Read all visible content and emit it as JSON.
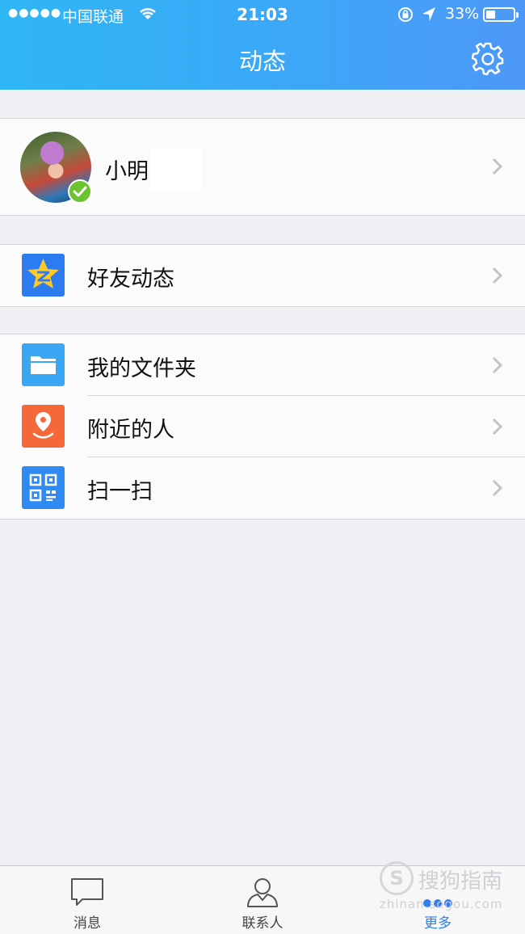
{
  "status_bar": {
    "signal": "●●●●●",
    "carrier": "中国联通",
    "time": "21:03",
    "battery_percent": "33%"
  },
  "header": {
    "title": "动态",
    "settings_icon": "gear-icon"
  },
  "profile": {
    "name": "小明",
    "badge": "check-icon"
  },
  "groups": [
    [
      {
        "label": "好友动态",
        "icon": "qzone-star-icon",
        "color": "#2d7bf0"
      }
    ],
    [
      {
        "label": "我的文件夹",
        "icon": "folder-icon",
        "color": "#39a7f3"
      },
      {
        "label": "附近的人",
        "icon": "location-pin-icon",
        "color": "#f5683a"
      },
      {
        "label": "扫一扫",
        "icon": "qr-code-icon",
        "color": "#2f8af3"
      }
    ]
  ],
  "tabbar": {
    "tabs": [
      {
        "label": "消息",
        "icon": "chat-bubble-icon"
      },
      {
        "label": "联系人",
        "icon": "person-icon"
      },
      {
        "label": "更多",
        "icon": "more-dots-icon",
        "active": true
      }
    ]
  },
  "colors": {
    "header_start": "#2fb6f5",
    "header_end": "#4d98f8",
    "active_tab": "#2d7ff2"
  },
  "watermark": {
    "logo": "S",
    "text": "搜狗指南",
    "url": "zhinan.sogou.com"
  }
}
